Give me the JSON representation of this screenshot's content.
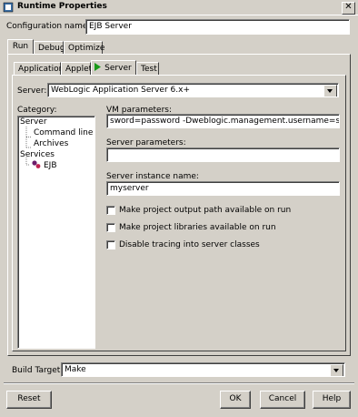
{
  "window": {
    "title": "Runtime Properties",
    "close_glyph": "✕"
  },
  "config": {
    "label": "Configuration name:",
    "value": "EJB Server"
  },
  "outer_tabs": [
    "Run",
    "Debug",
    "Optimize"
  ],
  "inner_tabs": {
    "application": "Application",
    "applet": "Applet",
    "server": "Server",
    "test": "Test"
  },
  "server": {
    "label": "Server:",
    "value": "WebLogic Application Server 6.x+"
  },
  "category": {
    "label": "Category:",
    "items": {
      "server": "Server",
      "command_line": "Command line",
      "archives": "Archives",
      "services": "Services",
      "ejb": "EJB"
    }
  },
  "vm_params": {
    "label": "VM parameters:",
    "value": "sword=password -Dweblogic.management.username=system"
  },
  "server_params": {
    "label": "Server parameters:",
    "value": ""
  },
  "server_instance": {
    "label": "Server instance name:",
    "value": "myserver"
  },
  "checks": {
    "output_path": "Make project output path available on run",
    "libraries": "Make project libraries available on run",
    "tracing": "Disable tracing into server classes"
  },
  "build_target": {
    "label": "Build Target:",
    "value": "Make"
  },
  "buttons": {
    "reset": "Reset",
    "ok": "OK",
    "cancel": "Cancel",
    "help": "Help"
  },
  "colors": {
    "face": "#d4d0c8",
    "shadow": "#808080",
    "dark": "#404040",
    "play": "#1a9a1a"
  }
}
